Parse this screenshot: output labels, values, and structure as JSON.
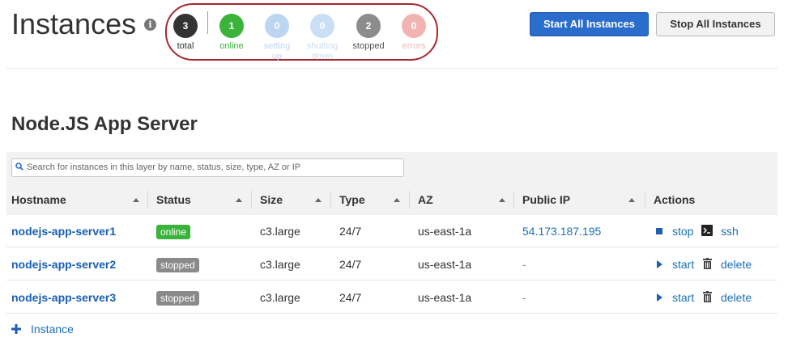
{
  "header": {
    "title": "Instances",
    "info_icon": "info-icon",
    "start_all_label": "Start All Instances",
    "stop_all_label": "Stop All Instances"
  },
  "status_summary": [
    {
      "count": "3",
      "label": "total",
      "circle_color": "#333333",
      "label_color": "#333333"
    },
    {
      "count": "1",
      "label": "online",
      "circle_color": "#3ab33a",
      "label_color": "#3ab33a"
    },
    {
      "count": "0",
      "label": "setting up",
      "circle_color": "#bcd6f2",
      "label_color": "#bcd6f2"
    },
    {
      "count": "0",
      "label": "shutting down",
      "circle_color": "#c9dff5",
      "label_color": "#c9dff5"
    },
    {
      "count": "2",
      "label": "stopped",
      "circle_color": "#8c8c8c",
      "label_color": "#555555"
    },
    {
      "count": "0",
      "label": "errors",
      "circle_color": "#f2b3b3",
      "label_color": "#f2b3b3"
    }
  ],
  "layer": {
    "title": "Node.JS App Server",
    "search_placeholder": "Search for instances in this layer by name, status, size, type, AZ or IP"
  },
  "table": {
    "columns": [
      "Hostname",
      "Status",
      "Size",
      "Type",
      "AZ",
      "Public IP",
      "Actions"
    ],
    "rows": [
      {
        "hostname": "nodejs-app-server1",
        "status": "online",
        "size": "c3.large",
        "type": "24/7",
        "az": "us-east-1a",
        "public_ip": "54.173.187.195",
        "action1": "stop",
        "action1_icon": "stop-icon",
        "action2": "ssh",
        "action2_icon": "terminal-icon"
      },
      {
        "hostname": "nodejs-app-server2",
        "status": "stopped",
        "size": "c3.large",
        "type": "24/7",
        "az": "us-east-1a",
        "public_ip": "-",
        "action1": "start",
        "action1_icon": "play-icon",
        "action2": "delete",
        "action2_icon": "trash-icon"
      },
      {
        "hostname": "nodejs-app-server3",
        "status": "stopped",
        "size": "c3.large",
        "type": "24/7",
        "az": "us-east-1a",
        "public_ip": "-",
        "action1": "start",
        "action1_icon": "play-icon",
        "action2": "delete",
        "action2_icon": "trash-icon"
      }
    ]
  },
  "footer": {
    "add_instance_label": "Instance"
  },
  "colors": {
    "primary_button": "#2b6dcc",
    "link": "#1a6fb8",
    "online": "#3ab33a",
    "stopped": "#8a8a8a",
    "highlight_oval": "#a8282d"
  }
}
